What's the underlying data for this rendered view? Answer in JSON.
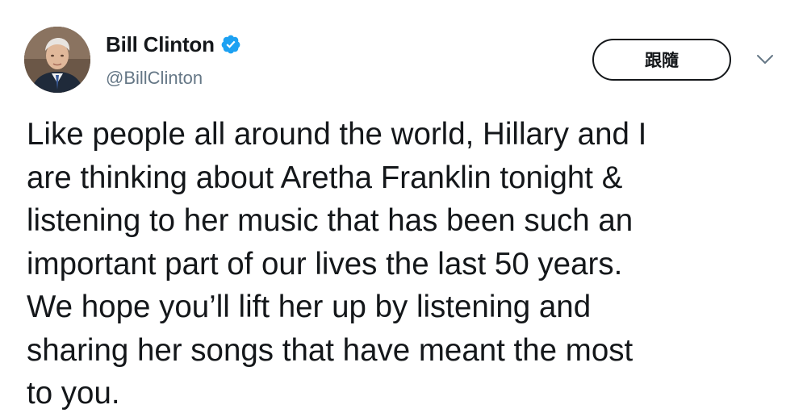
{
  "author": {
    "display_name": "Bill Clinton",
    "handle": "@BillClinton",
    "verified": true,
    "verified_icon": "verified-badge-icon",
    "verified_color": "#1da1f2",
    "avatar_icon": "profile-avatar"
  },
  "actions": {
    "follow_label": "跟隨",
    "menu_icon": "chevron-down-icon"
  },
  "tweet": {
    "lines": [
      "Like people all around the world, Hillary and I",
      "are thinking about Aretha Franklin tonight &",
      "listening to her music that has been such an",
      "important part of our lives the last 50 years.",
      "We hope you’ll lift her up by listening and",
      "sharing her songs that have meant the most",
      "to you."
    ]
  }
}
